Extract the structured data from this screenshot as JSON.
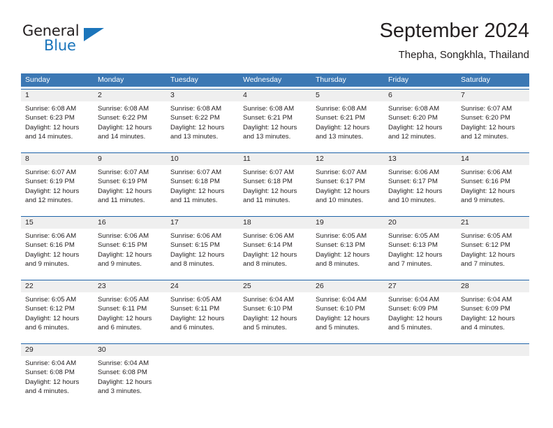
{
  "logo": {
    "primary_text": "General",
    "secondary_text": "Blue",
    "accent_color": "#1b75bb"
  },
  "header": {
    "month_title": "September 2024",
    "location": "Thepha, Songkhla, Thailand"
  },
  "calendar": {
    "header_color": "#3c78b4",
    "weekdays": [
      "Sunday",
      "Monday",
      "Tuesday",
      "Wednesday",
      "Thursday",
      "Friday",
      "Saturday"
    ],
    "weeks": [
      [
        {
          "day": "1",
          "sunrise": "Sunrise: 6:08 AM",
          "sunset": "Sunset: 6:23 PM",
          "daylight_line1": "Daylight: 12 hours",
          "daylight_line2": "and 14 minutes."
        },
        {
          "day": "2",
          "sunrise": "Sunrise: 6:08 AM",
          "sunset": "Sunset: 6:22 PM",
          "daylight_line1": "Daylight: 12 hours",
          "daylight_line2": "and 14 minutes."
        },
        {
          "day": "3",
          "sunrise": "Sunrise: 6:08 AM",
          "sunset": "Sunset: 6:22 PM",
          "daylight_line1": "Daylight: 12 hours",
          "daylight_line2": "and 13 minutes."
        },
        {
          "day": "4",
          "sunrise": "Sunrise: 6:08 AM",
          "sunset": "Sunset: 6:21 PM",
          "daylight_line1": "Daylight: 12 hours",
          "daylight_line2": "and 13 minutes."
        },
        {
          "day": "5",
          "sunrise": "Sunrise: 6:08 AM",
          "sunset": "Sunset: 6:21 PM",
          "daylight_line1": "Daylight: 12 hours",
          "daylight_line2": "and 13 minutes."
        },
        {
          "day": "6",
          "sunrise": "Sunrise: 6:08 AM",
          "sunset": "Sunset: 6:20 PM",
          "daylight_line1": "Daylight: 12 hours",
          "daylight_line2": "and 12 minutes."
        },
        {
          "day": "7",
          "sunrise": "Sunrise: 6:07 AM",
          "sunset": "Sunset: 6:20 PM",
          "daylight_line1": "Daylight: 12 hours",
          "daylight_line2": "and 12 minutes."
        }
      ],
      [
        {
          "day": "8",
          "sunrise": "Sunrise: 6:07 AM",
          "sunset": "Sunset: 6:19 PM",
          "daylight_line1": "Daylight: 12 hours",
          "daylight_line2": "and 12 minutes."
        },
        {
          "day": "9",
          "sunrise": "Sunrise: 6:07 AM",
          "sunset": "Sunset: 6:19 PM",
          "daylight_line1": "Daylight: 12 hours",
          "daylight_line2": "and 11 minutes."
        },
        {
          "day": "10",
          "sunrise": "Sunrise: 6:07 AM",
          "sunset": "Sunset: 6:18 PM",
          "daylight_line1": "Daylight: 12 hours",
          "daylight_line2": "and 11 minutes."
        },
        {
          "day": "11",
          "sunrise": "Sunrise: 6:07 AM",
          "sunset": "Sunset: 6:18 PM",
          "daylight_line1": "Daylight: 12 hours",
          "daylight_line2": "and 11 minutes."
        },
        {
          "day": "12",
          "sunrise": "Sunrise: 6:07 AM",
          "sunset": "Sunset: 6:17 PM",
          "daylight_line1": "Daylight: 12 hours",
          "daylight_line2": "and 10 minutes."
        },
        {
          "day": "13",
          "sunrise": "Sunrise: 6:06 AM",
          "sunset": "Sunset: 6:17 PM",
          "daylight_line1": "Daylight: 12 hours",
          "daylight_line2": "and 10 minutes."
        },
        {
          "day": "14",
          "sunrise": "Sunrise: 6:06 AM",
          "sunset": "Sunset: 6:16 PM",
          "daylight_line1": "Daylight: 12 hours",
          "daylight_line2": "and 9 minutes."
        }
      ],
      [
        {
          "day": "15",
          "sunrise": "Sunrise: 6:06 AM",
          "sunset": "Sunset: 6:16 PM",
          "daylight_line1": "Daylight: 12 hours",
          "daylight_line2": "and 9 minutes."
        },
        {
          "day": "16",
          "sunrise": "Sunrise: 6:06 AM",
          "sunset": "Sunset: 6:15 PM",
          "daylight_line1": "Daylight: 12 hours",
          "daylight_line2": "and 9 minutes."
        },
        {
          "day": "17",
          "sunrise": "Sunrise: 6:06 AM",
          "sunset": "Sunset: 6:15 PM",
          "daylight_line1": "Daylight: 12 hours",
          "daylight_line2": "and 8 minutes."
        },
        {
          "day": "18",
          "sunrise": "Sunrise: 6:06 AM",
          "sunset": "Sunset: 6:14 PM",
          "daylight_line1": "Daylight: 12 hours",
          "daylight_line2": "and 8 minutes."
        },
        {
          "day": "19",
          "sunrise": "Sunrise: 6:05 AM",
          "sunset": "Sunset: 6:13 PM",
          "daylight_line1": "Daylight: 12 hours",
          "daylight_line2": "and 8 minutes."
        },
        {
          "day": "20",
          "sunrise": "Sunrise: 6:05 AM",
          "sunset": "Sunset: 6:13 PM",
          "daylight_line1": "Daylight: 12 hours",
          "daylight_line2": "and 7 minutes."
        },
        {
          "day": "21",
          "sunrise": "Sunrise: 6:05 AM",
          "sunset": "Sunset: 6:12 PM",
          "daylight_line1": "Daylight: 12 hours",
          "daylight_line2": "and 7 minutes."
        }
      ],
      [
        {
          "day": "22",
          "sunrise": "Sunrise: 6:05 AM",
          "sunset": "Sunset: 6:12 PM",
          "daylight_line1": "Daylight: 12 hours",
          "daylight_line2": "and 6 minutes."
        },
        {
          "day": "23",
          "sunrise": "Sunrise: 6:05 AM",
          "sunset": "Sunset: 6:11 PM",
          "daylight_line1": "Daylight: 12 hours",
          "daylight_line2": "and 6 minutes."
        },
        {
          "day": "24",
          "sunrise": "Sunrise: 6:05 AM",
          "sunset": "Sunset: 6:11 PM",
          "daylight_line1": "Daylight: 12 hours",
          "daylight_line2": "and 6 minutes."
        },
        {
          "day": "25",
          "sunrise": "Sunrise: 6:04 AM",
          "sunset": "Sunset: 6:10 PM",
          "daylight_line1": "Daylight: 12 hours",
          "daylight_line2": "and 5 minutes."
        },
        {
          "day": "26",
          "sunrise": "Sunrise: 6:04 AM",
          "sunset": "Sunset: 6:10 PM",
          "daylight_line1": "Daylight: 12 hours",
          "daylight_line2": "and 5 minutes."
        },
        {
          "day": "27",
          "sunrise": "Sunrise: 6:04 AM",
          "sunset": "Sunset: 6:09 PM",
          "daylight_line1": "Daylight: 12 hours",
          "daylight_line2": "and 5 minutes."
        },
        {
          "day": "28",
          "sunrise": "Sunrise: 6:04 AM",
          "sunset": "Sunset: 6:09 PM",
          "daylight_line1": "Daylight: 12 hours",
          "daylight_line2": "and 4 minutes."
        }
      ],
      [
        {
          "day": "29",
          "sunrise": "Sunrise: 6:04 AM",
          "sunset": "Sunset: 6:08 PM",
          "daylight_line1": "Daylight: 12 hours",
          "daylight_line2": "and 4 minutes."
        },
        {
          "day": "30",
          "sunrise": "Sunrise: 6:04 AM",
          "sunset": "Sunset: 6:08 PM",
          "daylight_line1": "Daylight: 12 hours",
          "daylight_line2": "and 3 minutes."
        },
        {
          "day": "",
          "sunrise": "",
          "sunset": "",
          "daylight_line1": "",
          "daylight_line2": ""
        },
        {
          "day": "",
          "sunrise": "",
          "sunset": "",
          "daylight_line1": "",
          "daylight_line2": ""
        },
        {
          "day": "",
          "sunrise": "",
          "sunset": "",
          "daylight_line1": "",
          "daylight_line2": ""
        },
        {
          "day": "",
          "sunrise": "",
          "sunset": "",
          "daylight_line1": "",
          "daylight_line2": ""
        },
        {
          "day": "",
          "sunrise": "",
          "sunset": "",
          "daylight_line1": "",
          "daylight_line2": ""
        }
      ]
    ]
  }
}
